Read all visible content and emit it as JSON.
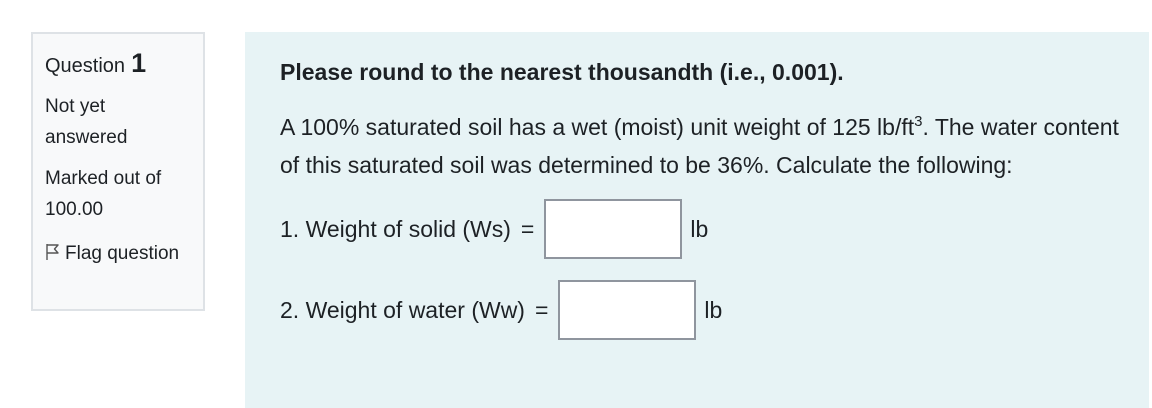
{
  "info": {
    "question_word": "Question",
    "question_number": "1",
    "state": "Not yet answered",
    "grade": "Marked out of 100.00",
    "flag_label": "Flag question"
  },
  "question": {
    "instruction": "Please round to the nearest thousandth (i.e., 0.001).",
    "prompt_before_sup": "A 100% saturated soil has a wet (moist) unit weight of 125 lb/ft",
    "prompt_sup": "3",
    "prompt_after_sup": ".  The water content of this saturated soil was determined to be 36%. Calculate the following:",
    "answers": [
      {
        "label": "1. Weight of solid (Ws)",
        "equals": "=",
        "value": "",
        "unit": "lb"
      },
      {
        "label": "2. Weight of water (Ww)",
        "equals": "=",
        "value": "",
        "unit": "lb"
      }
    ]
  },
  "icons": {
    "flag": "flag-outline-icon"
  }
}
